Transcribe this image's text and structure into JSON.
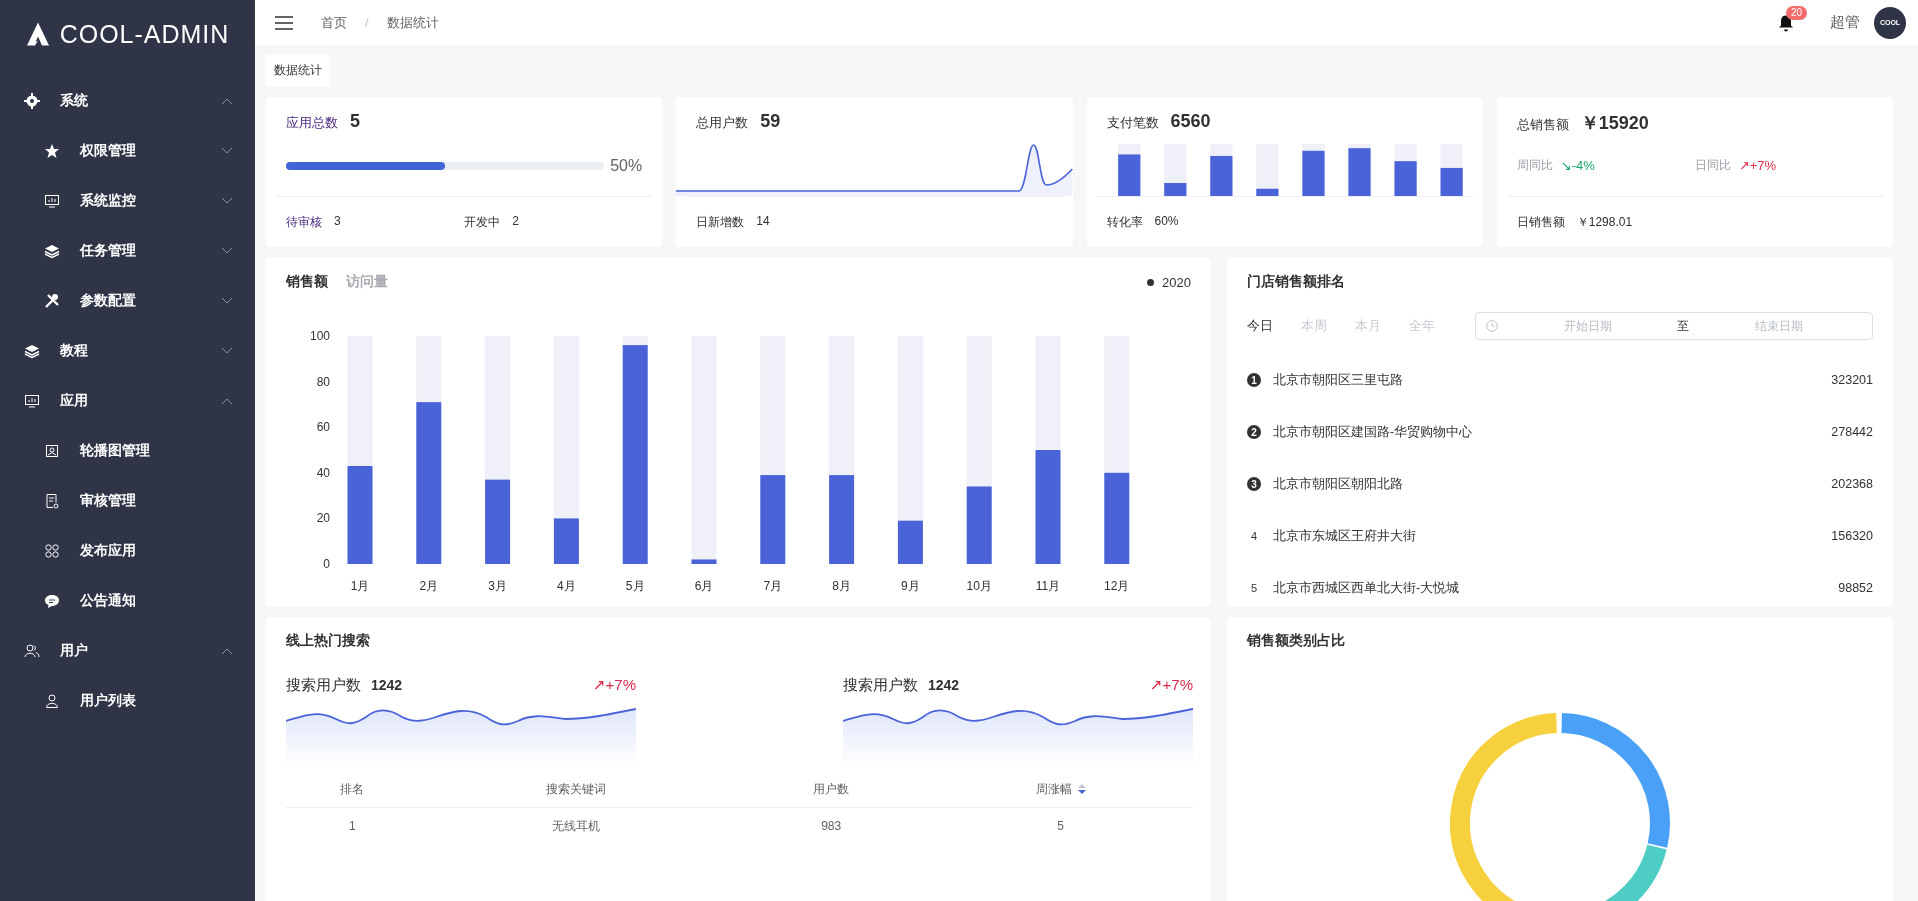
{
  "sidebar": {
    "logo": "COOL-ADMIN",
    "items": [
      {
        "label": "系统",
        "expanded": true,
        "children": [
          {
            "label": "权限管理",
            "expanded": false
          },
          {
            "label": "系统监控",
            "expanded": false
          },
          {
            "label": "任务管理",
            "expanded": false
          },
          {
            "label": "参数配置",
            "expanded": false
          }
        ]
      },
      {
        "label": "教程",
        "expanded": false
      },
      {
        "label": "应用",
        "expanded": true,
        "children": [
          {
            "label": "轮播图管理"
          },
          {
            "label": "审核管理"
          },
          {
            "label": "发布应用"
          },
          {
            "label": "公告通知"
          }
        ]
      },
      {
        "label": "用户",
        "expanded": true,
        "children": [
          {
            "label": "用户列表"
          }
        ]
      }
    ]
  },
  "header": {
    "breadcrumb": [
      "首页",
      "数据统计"
    ],
    "separator": "/",
    "notification_count": "20",
    "user_name": "超管",
    "avatar_text": "COOL"
  },
  "page_tabs": [
    {
      "label": "数据统计",
      "selected": true
    }
  ],
  "stat_cards": [
    {
      "kind": "progress",
      "title": "应用总数",
      "value": "5",
      "level": 0.5,
      "reading": "50%",
      "footer": [
        {
          "label": "待审核",
          "value": "3"
        },
        {
          "label": "开发中",
          "value": "2"
        }
      ]
    },
    {
      "kind": "sparkline",
      "title": "总用户数",
      "value": "59",
      "footer": [
        {
          "label": "日新增数",
          "value": "14"
        }
      ]
    },
    {
      "kind": "bars",
      "title": "支付笔数",
      "value": "6560",
      "footer": [
        {
          "label": "转化率",
          "value": "60%"
        }
      ]
    },
    {
      "kind": "trend",
      "title": "总销售额",
      "value": "￥15920",
      "trends": [
        {
          "label": "周同比",
          "value": "↘-4%",
          "color": "#19a96b"
        },
        {
          "label": "日同比",
          "value": "↗+7%",
          "color": "#e0294a"
        }
      ],
      "footer": [
        {
          "label": "日销售额",
          "value": "￥1298.01"
        }
      ]
    }
  ],
  "sales_chart": {
    "tabs": [
      {
        "label": "销售额",
        "selected": true
      },
      {
        "label": "访问量",
        "selected": false
      }
    ],
    "chart_data": {
      "type": "bar",
      "categories": [
        "1月",
        "2月",
        "3月",
        "4月",
        "5月",
        "6月",
        "7月",
        "8月",
        "9月",
        "10月",
        "11月",
        "12月"
      ],
      "series": [
        {
          "name": "2020",
          "color": "#4a63d8",
          "values": [
            43,
            71,
            37,
            20,
            96,
            2,
            39,
            39,
            19,
            34,
            50,
            40
          ]
        }
      ],
      "ylim": [
        0,
        100
      ],
      "yticks": [
        0,
        20,
        40,
        60,
        80,
        100
      ]
    }
  },
  "store_ranking": {
    "title": "门店销售额排名",
    "periods": [
      {
        "label": "今日",
        "selected": true
      },
      {
        "label": "本周",
        "selected": false
      },
      {
        "label": "本月",
        "selected": false
      },
      {
        "label": "全年",
        "selected": false
      }
    ],
    "date_range": {
      "start_placeholder": "开始日期",
      "separator": "至",
      "end_placeholder": "结束日期"
    },
    "rows": [
      {
        "rank": "1",
        "kind": "badge",
        "name": "北京市朝阳区三里屯路",
        "amount": "323201"
      },
      {
        "rank": "2",
        "kind": "badge",
        "name": "北京市朝阳区建国路-华贸购物中心",
        "amount": "278442"
      },
      {
        "rank": "3",
        "kind": "badge",
        "name": "北京市朝阳区朝阳北路",
        "amount": "202368"
      },
      {
        "rank": "4",
        "kind": "plain",
        "name": "北京市东城区王府井大街",
        "amount": "156320"
      },
      {
        "rank": "5",
        "kind": "plain",
        "name": "北京市西城区西单北大街-大悦城",
        "amount": "98852"
      }
    ]
  },
  "hot_search": {
    "title": "线上热门搜索",
    "stats": [
      {
        "label": "搜索用户数",
        "value": "1242",
        "change": "↗+7%"
      },
      {
        "label": "搜索用户数",
        "value": "1242",
        "change": "↗+7%"
      }
    ],
    "table": {
      "columns": [
        {
          "label": "排名",
          "sortable": false
        },
        {
          "label": "搜索关键词",
          "sortable": false
        },
        {
          "label": "用户数",
          "sortable": false
        },
        {
          "label": "周涨幅",
          "sortable": true
        }
      ],
      "rows": [
        [
          "1",
          "无线耳机",
          "983",
          "5"
        ]
      ]
    }
  },
  "category_share": {
    "title": "销售额类别占比"
  }
}
